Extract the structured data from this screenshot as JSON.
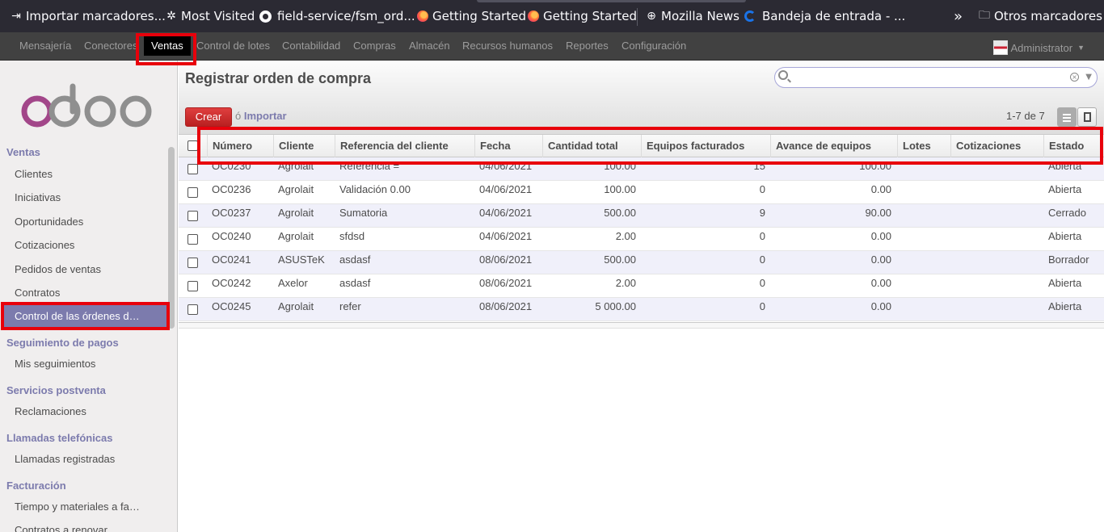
{
  "bookmarks": [
    {
      "label": "Importar marcadores...",
      "icon": "import-icon"
    },
    {
      "label": "Most Visited",
      "icon": "gear-icon"
    },
    {
      "label": "field-service/fsm_ord...",
      "icon": "github-icon"
    },
    {
      "label": "Getting Started",
      "icon": "firefox-icon"
    },
    {
      "label": "Getting Started",
      "icon": "firefox-icon"
    },
    {
      "label": "Mozilla News",
      "icon": "globe-icon"
    },
    {
      "label": "Bandeja de entrada - ...",
      "icon": "mail-icon"
    }
  ],
  "bookmarks_overflow": "»",
  "other_bookmarks": "Otros marcadores",
  "topmenu": {
    "items": [
      "Mensajería",
      "Conectores",
      "Ventas",
      "Control de lotes",
      "Contabilidad",
      "Compras",
      "Almacén",
      "Recursos humanos",
      "Reportes",
      "Configuración"
    ],
    "active": "Ventas",
    "user": "Administrator"
  },
  "sidebar": {
    "sections": [
      {
        "title": "Ventas",
        "items": [
          "Clientes",
          "Iniciativas",
          "Oportunidades",
          "Cotizaciones",
          "Pedidos de ventas",
          "Contratos",
          "Control de las órdenes d…"
        ]
      },
      {
        "title": "Seguimiento de pagos",
        "items": [
          "Mis seguimientos"
        ]
      },
      {
        "title": "Servicios postventa",
        "items": [
          "Reclamaciones"
        ]
      },
      {
        "title": "Llamadas telefónicas",
        "items": [
          "Llamadas registradas"
        ]
      },
      {
        "title": "Facturación",
        "items": [
          "Tiempo y materiales a fa…",
          "Contratos a renovar"
        ]
      }
    ],
    "active_item": "Control de las órdenes d…"
  },
  "main": {
    "title": "Registrar orden de compra",
    "search_placeholder": "",
    "create_label": "Crear",
    "or_label": "ó",
    "import_label": "Importar",
    "pager": "1-7 de 7"
  },
  "table": {
    "columns": [
      "Número",
      "Cliente",
      "Referencia del cliente",
      "Fecha",
      "Cantidad total",
      "Equipos facturados",
      "Avance de equipos",
      "Lotes",
      "Cotizaciones",
      "Estado"
    ],
    "rows": [
      [
        "OC0230",
        "Agrolait",
        "Referencia =",
        "04/06/2021",
        "100.00",
        "15",
        "100.00",
        "",
        "",
        "Abierta"
      ],
      [
        "OC0236",
        "Agrolait",
        "Validación 0.00",
        "04/06/2021",
        "100.00",
        "0",
        "0.00",
        "",
        "",
        "Abierta"
      ],
      [
        "OC0237",
        "Agrolait",
        "Sumatoria",
        "04/06/2021",
        "500.00",
        "9",
        "90.00",
        "",
        "",
        "Cerrado"
      ],
      [
        "OC0240",
        "Agrolait",
        "sfdsd",
        "04/06/2021",
        "2.00",
        "0",
        "0.00",
        "",
        "",
        "Abierta"
      ],
      [
        "OC0241",
        "ASUSTeK",
        "asdasf",
        "08/06/2021",
        "500.00",
        "0",
        "0.00",
        "",
        "",
        "Borrador"
      ],
      [
        "OC0242",
        "Axelor",
        "asdasf",
        "08/06/2021",
        "2.00",
        "0",
        "0.00",
        "",
        "",
        "Abierta"
      ],
      [
        "OC0245",
        "Agrolait",
        "refer",
        "08/06/2021",
        "5 000.00",
        "0",
        "0.00",
        "",
        "",
        "Abierta"
      ]
    ]
  },
  "colors": {
    "accent": "#7c7bad",
    "annotation": "#e8000b",
    "create_button": "#c82424"
  }
}
